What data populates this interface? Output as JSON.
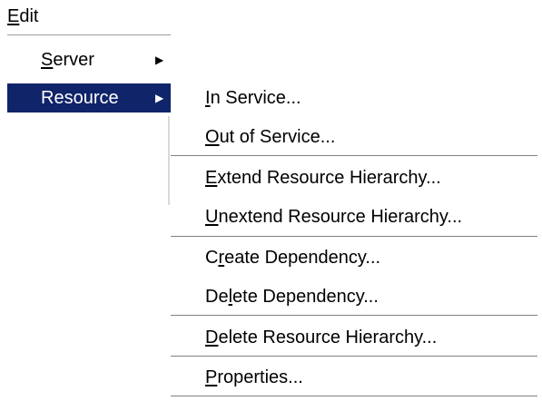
{
  "menubar": {
    "edit": {
      "pre": "",
      "key": "E",
      "post": "dit"
    }
  },
  "edit_menu": {
    "items": [
      {
        "pre": "",
        "key": "S",
        "post": "erver",
        "arrow": "▶"
      },
      {
        "pre": "Resource",
        "key": "",
        "post": "",
        "arrow": "▶"
      }
    ]
  },
  "resource_submenu": {
    "items": [
      {
        "pre": "",
        "key": "I",
        "post": "n Service..."
      },
      {
        "pre": "",
        "key": "O",
        "post": "ut of Service..."
      },
      {
        "pre": "",
        "key": "E",
        "post": "xtend Resource Hierarchy..."
      },
      {
        "pre": "",
        "key": "U",
        "post": "nextend Resource Hierarchy..."
      },
      {
        "pre": "C",
        "key": "r",
        "post": "eate Dependency..."
      },
      {
        "pre": "De",
        "key": "l",
        "post": "ete Dependency..."
      },
      {
        "pre": "",
        "key": "D",
        "post": "elete Resource Hierarchy..."
      },
      {
        "pre": "",
        "key": "P",
        "post": "roperties..."
      }
    ]
  },
  "colors": {
    "highlight": "#10246a",
    "separator": "#808080"
  }
}
